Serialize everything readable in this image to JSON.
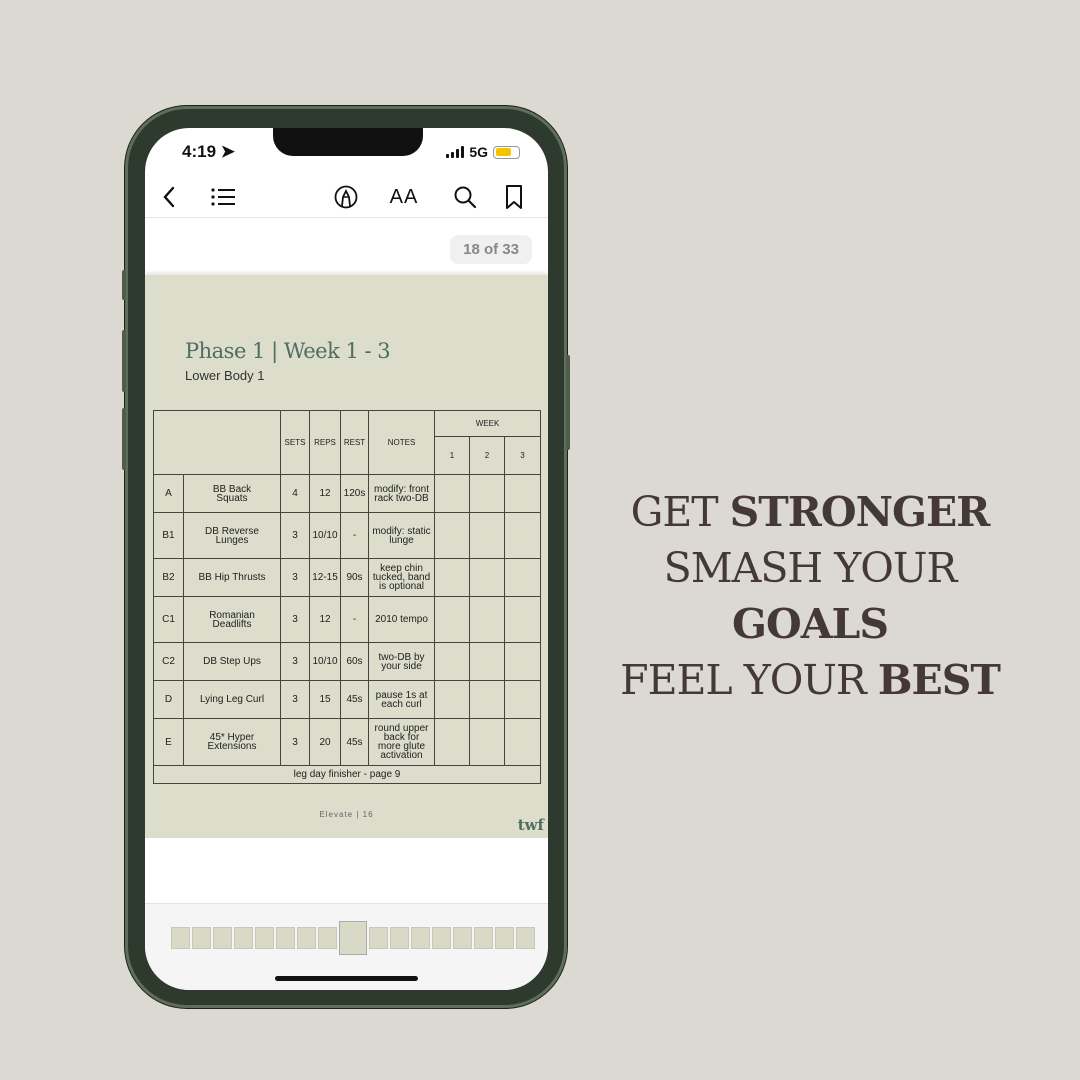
{
  "status": {
    "time": "4:19",
    "network": "5G",
    "battery_color": "#f5c400"
  },
  "toolbar": {
    "icons": [
      "back-chevron-icon",
      "list-icon",
      "markup-pen-icon",
      "text-size-icon",
      "search-icon",
      "bookmark-icon"
    ],
    "text_size_label": "AA"
  },
  "page_indicator": "18 of 33",
  "doc": {
    "title": "Phase 1 | Week 1 - 3",
    "subtitle": "Lower Body 1",
    "headers": {
      "sets": "SETS",
      "reps": "REPS",
      "rest": "REST",
      "notes": "NOTES",
      "week": "WEEK",
      "weeks": [
        "1",
        "2",
        "3"
      ]
    },
    "rows": [
      {
        "id": "A",
        "exercise": "BB Back Squats",
        "sets": "4",
        "reps": "12",
        "rest": "120s",
        "notes": "modify: front rack two-DB"
      },
      {
        "id": "B1",
        "exercise": "DB Reverse Lunges",
        "sets": "3",
        "reps": "10/10",
        "rest": "-",
        "notes": "modify: static lunge"
      },
      {
        "id": "B2",
        "exercise": "BB Hip Thrusts",
        "sets": "3",
        "reps": "12-15",
        "rest": "90s",
        "notes": "keep chin tucked, band is optional"
      },
      {
        "id": "C1",
        "exercise": "Romanian Deadlifts",
        "sets": "3",
        "reps": "12",
        "rest": "-",
        "notes": "2010 tempo"
      },
      {
        "id": "C2",
        "exercise": "DB Step Ups",
        "sets": "3",
        "reps": "10/10",
        "rest": "60s",
        "notes": "two-DB by your side"
      },
      {
        "id": "D",
        "exercise": "Lying Leg Curl",
        "sets": "3",
        "reps": "15",
        "rest": "45s",
        "notes": "pause 1s at each curl"
      },
      {
        "id": "E",
        "exercise": "45* Hyper Extensions",
        "sets": "3",
        "reps": "20",
        "rest": "45s",
        "notes": "round upper back for more glute activation"
      }
    ],
    "footer_note": "leg day finisher - page 9",
    "page_footer": "Elevate | 16",
    "logo": "twf"
  },
  "thumbnails": {
    "count": 17,
    "current_index": 8
  },
  "tagline": [
    {
      "regular": "GET ",
      "bold": "STRONGER"
    },
    {
      "regular": "SMASH YOUR ",
      "bold": "GOALS"
    },
    {
      "regular": "FEEL YOUR ",
      "bold": "BEST"
    }
  ]
}
